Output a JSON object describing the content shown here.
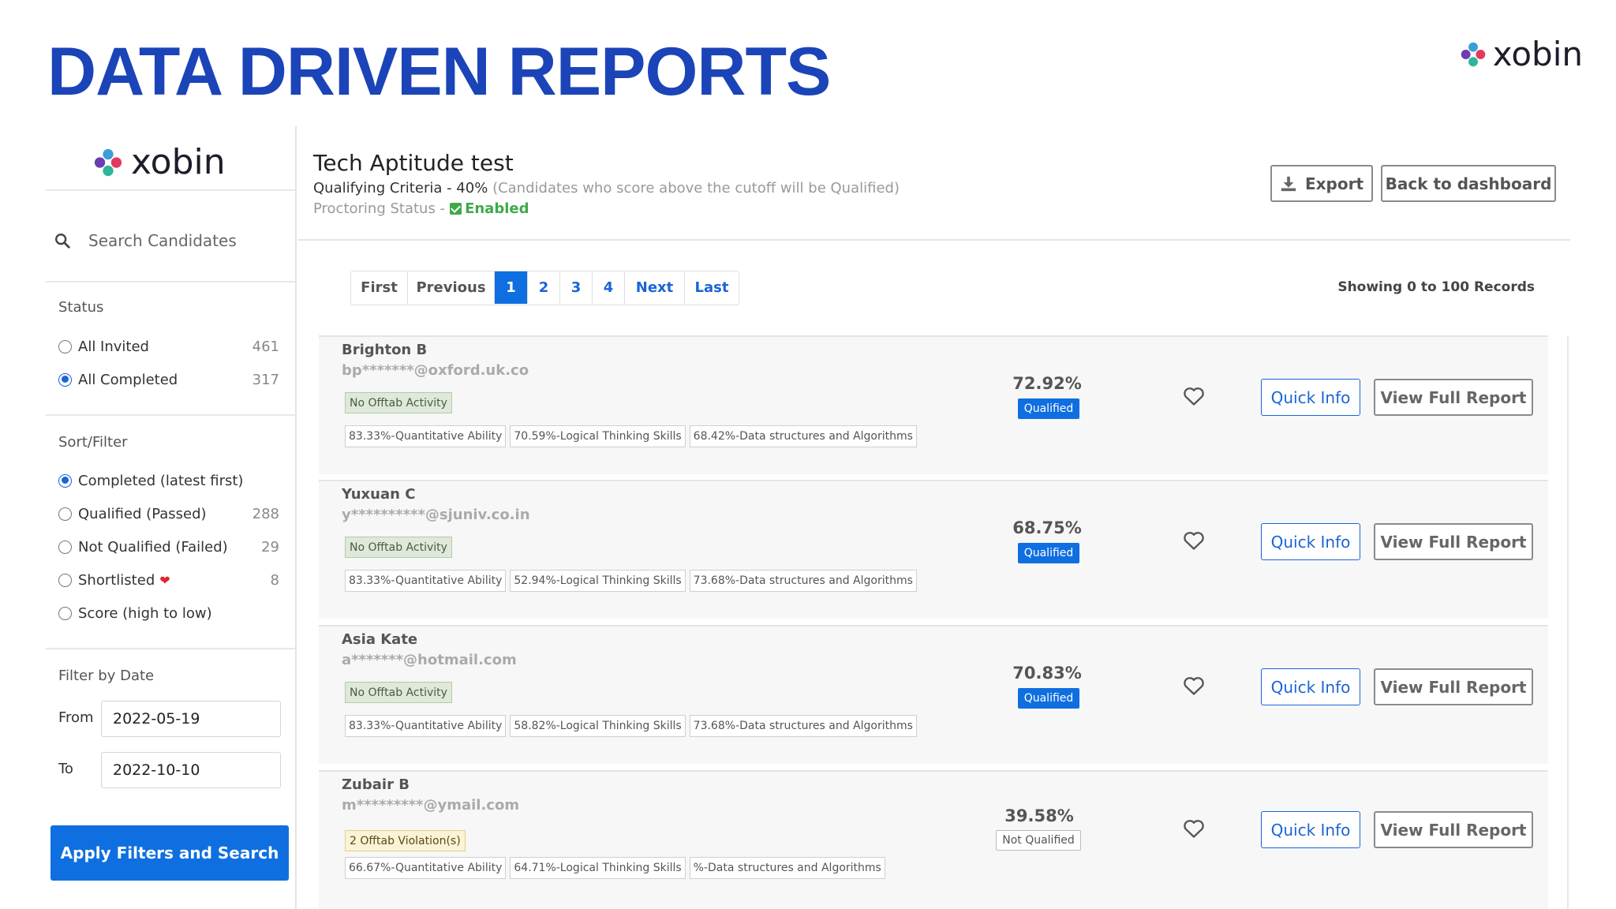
{
  "slide": {
    "title": "DATA DRIVEN REPORTS",
    "brand": "xobin"
  },
  "sidebar": {
    "brand": "xobin",
    "search": {
      "placeholder": "Search Candidates",
      "value": ""
    },
    "status": {
      "heading": "Status",
      "options": [
        {
          "label": "All Invited",
          "count": "461",
          "selected": false
        },
        {
          "label": "All Completed",
          "count": "317",
          "selected": true
        }
      ]
    },
    "sort_filter": {
      "heading": "Sort/Filter",
      "options": [
        {
          "label": "Completed (latest first)",
          "count": "",
          "selected": true
        },
        {
          "label": "Qualified (Passed)",
          "count": "288",
          "selected": false
        },
        {
          "label": "Not Qualified (Failed)",
          "count": "29",
          "selected": false
        },
        {
          "label": "Shortlisted",
          "count": "8",
          "selected": false
        },
        {
          "label": "Score (high to low)",
          "count": "",
          "selected": false
        }
      ]
    },
    "date_filter": {
      "heading": "Filter by Date",
      "from_label": "From",
      "from_value": "2022-05-19",
      "to_label": "To",
      "to_value": "2022-10-10"
    },
    "apply_label": "Apply Filters and Search"
  },
  "header": {
    "test_title": "Tech Aptitude test",
    "criteria_label": "Qualifying Criteria - 40%",
    "criteria_note": "(Candidates who score above the cutoff will be Qualified)",
    "proctoring_label": "Proctoring Status -",
    "proctoring_value": "Enabled",
    "export_label": "Export",
    "back_label": "Back to dashboard"
  },
  "pagination": {
    "first": "First",
    "previous": "Previous",
    "pages": [
      "1",
      "2",
      "3",
      "4"
    ],
    "active_page": "1",
    "next": "Next",
    "last": "Last",
    "showing": "Showing 0 to 100 Records"
  },
  "candidates": [
    {
      "name": "Brighton B",
      "email": "bp*******@oxford.uk.co",
      "offtab": "No Offtab Activity",
      "skills": [
        "83.33%-Quantitative Ability",
        "70.59%-Logical Thinking Skills",
        "68.42%-Data structures and Algorithms"
      ],
      "score": "72.92%",
      "status": "Qualified",
      "quick_info": "Quick Info",
      "full_report": "View Full Report"
    },
    {
      "name": "Yuxuan C",
      "email": "y**********@sjuniv.co.in",
      "offtab": "No Offtab Activity",
      "skills": [
        "83.33%-Quantitative Ability",
        "52.94%-Logical Thinking Skills",
        "73.68%-Data structures and Algorithms"
      ],
      "score": "68.75%",
      "status": "Qualified",
      "quick_info": "Quick Info",
      "full_report": "View Full Report"
    },
    {
      "name": "Asia Kate",
      "email": "a*******@hotmail.com",
      "offtab": "No Offtab Activity",
      "skills": [
        "83.33%-Quantitative Ability",
        "58.82%-Logical Thinking Skills",
        "73.68%-Data structures and Algorithms"
      ],
      "score": "70.83%",
      "status": "Qualified",
      "quick_info": "Quick Info",
      "full_report": "View Full Report"
    },
    {
      "name": "Zubair B",
      "email": "m*********@ymail.com",
      "offtab": "2 Offtab Violation(s)",
      "skills": [
        "66.67%-Quantitative Ability",
        "64.71%-Logical Thinking Skills",
        "%-Data structures and Algorithms"
      ],
      "score": "39.58%",
      "status": "Not Qualified",
      "quick_info": "Quick Info",
      "full_report": "View Full Report"
    }
  ],
  "colors": {
    "accent_blue": "#0f6fe0",
    "title_blue": "#1b44b8",
    "enabled_green": "#3fa84a",
    "shortlist_red": "#e0262f"
  },
  "icons": [
    "xobin-logo-icon",
    "search-icon",
    "download-icon",
    "heart-icon",
    "check-icon"
  ]
}
